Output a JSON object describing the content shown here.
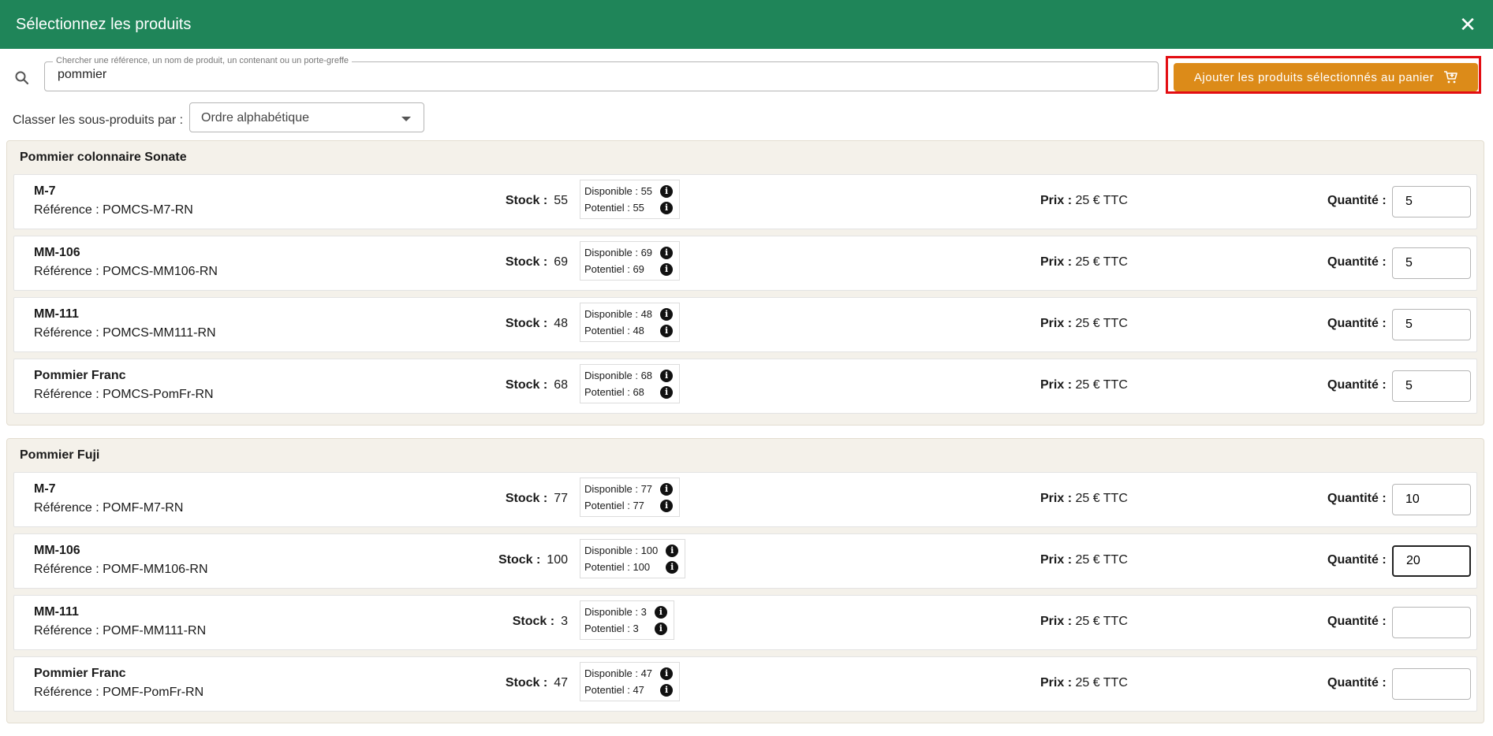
{
  "header": {
    "title": "Sélectionnez les produits",
    "close": "✕"
  },
  "search": {
    "label": "Chercher une référence, un nom de produit, un contenant ou un porte-greffe",
    "value": "pommier"
  },
  "add_button": {
    "label": "Ajouter les produits sélectionnés au panier",
    "icon": "cart-plus-icon"
  },
  "sort": {
    "label": "Classer les sous-produits par :",
    "value": "Ordre alphabétique"
  },
  "labels": {
    "stock": "Stock :",
    "disponible": "Disponible :",
    "potentiel": "Potentiel :",
    "prix": "Prix :",
    "quantite": "Quantité :"
  },
  "groups": [
    {
      "title": "Pommier colonnaire Sonate",
      "items": [
        {
          "name": "M-7",
          "reference": "Référence : POMCS-M7-RN",
          "stock": "55",
          "disponible": "55",
          "potentiel": "55",
          "price": "25 € TTC",
          "quantity": "5"
        },
        {
          "name": "MM-106",
          "reference": "Référence : POMCS-MM106-RN",
          "stock": "69",
          "disponible": "69",
          "potentiel": "69",
          "price": "25 € TTC",
          "quantity": "5"
        },
        {
          "name": "MM-111",
          "reference": "Référence : POMCS-MM111-RN",
          "stock": "48",
          "disponible": "48",
          "potentiel": "48",
          "price": "25 € TTC",
          "quantity": "5"
        },
        {
          "name": "Pommier Franc",
          "reference": "Référence : POMCS-PomFr-RN",
          "stock": "68",
          "disponible": "68",
          "potentiel": "68",
          "price": "25 € TTC",
          "quantity": "5"
        }
      ]
    },
    {
      "title": "Pommier Fuji",
      "items": [
        {
          "name": "M-7",
          "reference": "Référence : POMF-M7-RN",
          "stock": "77",
          "disponible": "77",
          "potentiel": "77",
          "price": "25 € TTC",
          "quantity": "10"
        },
        {
          "name": "MM-106",
          "reference": "Référence : POMF-MM106-RN",
          "stock": "100",
          "disponible": "100",
          "potentiel": "100",
          "price": "25 € TTC",
          "quantity": "20",
          "focused": true
        },
        {
          "name": "MM-111",
          "reference": "Référence : POMF-MM111-RN",
          "stock": "3",
          "disponible": "3",
          "potentiel": "3",
          "price": "25 € TTC",
          "quantity": ""
        },
        {
          "name": "Pommier Franc",
          "reference": "Référence : POMF-PomFr-RN",
          "stock": "47",
          "disponible": "47",
          "potentiel": "47",
          "price": "25 € TTC",
          "quantity": ""
        }
      ]
    }
  ]
}
